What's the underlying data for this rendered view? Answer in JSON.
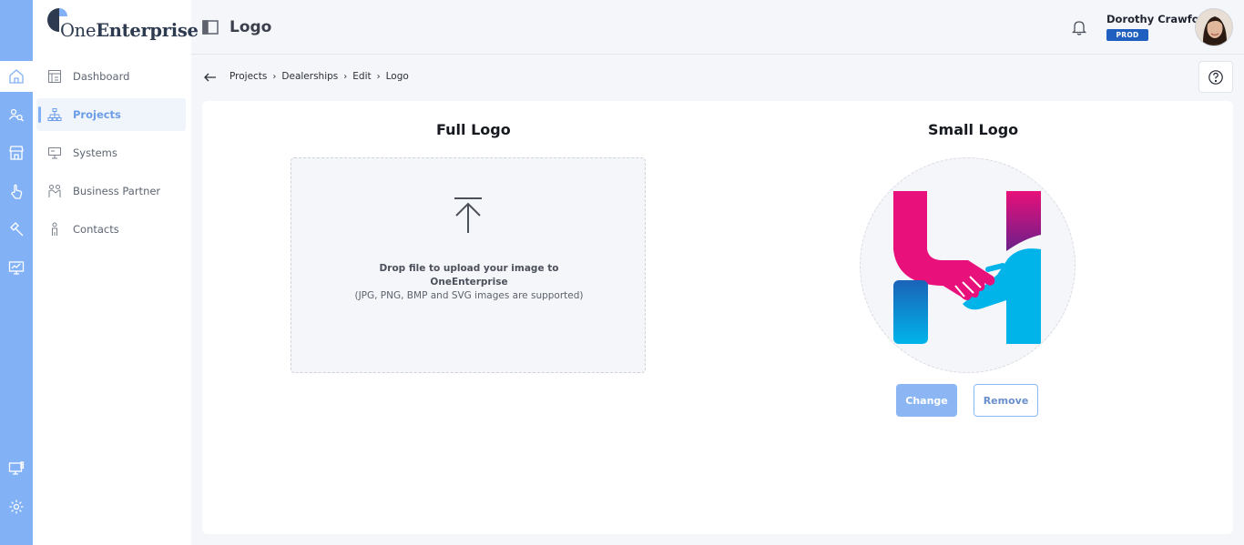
{
  "brand": {
    "name_light": "One",
    "name_bold": "Enterprise"
  },
  "rail": {
    "icons": [
      "home-icon",
      "people-search-icon",
      "store-icon",
      "hand-pointer-icon",
      "hammer-icon",
      "monitor-chart-icon",
      "monitor-grid-icon",
      "gear-icon"
    ],
    "active": "home-icon"
  },
  "sidebar": {
    "items": [
      {
        "label": "Dashboard",
        "icon": "dashboard-icon"
      },
      {
        "label": "Projects",
        "icon": "hierarchy-icon",
        "active": true
      },
      {
        "label": "Systems",
        "icon": "systems-icon"
      },
      {
        "label": "Business Partner",
        "icon": "partners-icon"
      },
      {
        "label": "Contacts",
        "icon": "person-icon"
      }
    ]
  },
  "header": {
    "title": "Logo",
    "user_name": "Dorothy Crawford",
    "environment": "PROD"
  },
  "breadcrumb": [
    "Projects",
    "Dealerships",
    "Edit",
    "Logo"
  ],
  "full_logo": {
    "title": "Full Logo",
    "drop_text": "Drop file to upload your image to OneEnterprise",
    "supported_text": "(JPG, PNG, BMP and SVG images are supported)"
  },
  "small_logo": {
    "title": "Small Logo",
    "change_label": "Change",
    "remove_label": "Remove"
  },
  "colors": {
    "rail": "#83b1f5",
    "accent": "#6b9de8",
    "badge": "#1f5fbf",
    "logo_pink": "#e8107a",
    "logo_cyan": "#00b0e8"
  }
}
